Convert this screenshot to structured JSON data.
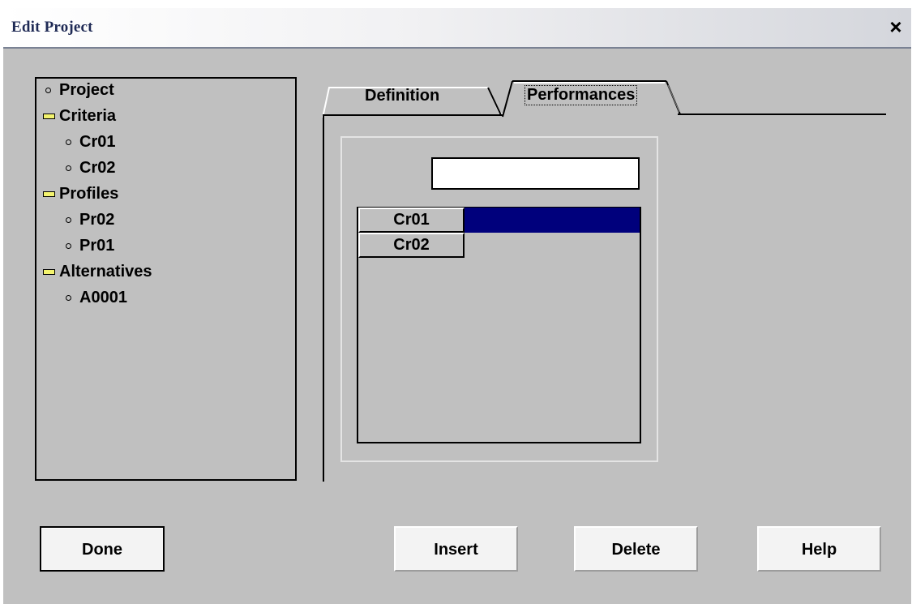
{
  "window": {
    "title": "Edit Project",
    "close_symbol": "×"
  },
  "tree": {
    "items": [
      {
        "label": "Project",
        "marker": "bullet",
        "level": 0
      },
      {
        "label": "Criteria",
        "marker": "minus-box",
        "level": 0
      },
      {
        "label": "Cr01",
        "marker": "bullet",
        "level": 1
      },
      {
        "label": "Cr02",
        "marker": "bullet",
        "level": 1
      },
      {
        "label": "Profiles",
        "marker": "minus-box",
        "level": 0
      },
      {
        "label": "Pr02",
        "marker": "bullet",
        "level": 1
      },
      {
        "label": "Pr01",
        "marker": "bullet",
        "level": 1
      },
      {
        "label": "Alternatives",
        "marker": "minus-box",
        "level": 0
      },
      {
        "label": "A0001",
        "marker": "bullet",
        "level": 1
      }
    ]
  },
  "tabs": {
    "definition": "Definition",
    "performances": "Performances",
    "active": "performances"
  },
  "performance_input": {
    "value": ""
  },
  "grid": {
    "rows": [
      {
        "header": "Cr01",
        "selected": true
      },
      {
        "header": "Cr02",
        "selected": false
      }
    ],
    "selection_color": "#00007c"
  },
  "buttons": {
    "done": "Done",
    "insert": "Insert",
    "delete": "Delete",
    "help": "Help"
  },
  "colors": {
    "window_bg": "#c0c0c0",
    "title_text": "#1f2a55",
    "minus_box": "#f3f36e"
  }
}
